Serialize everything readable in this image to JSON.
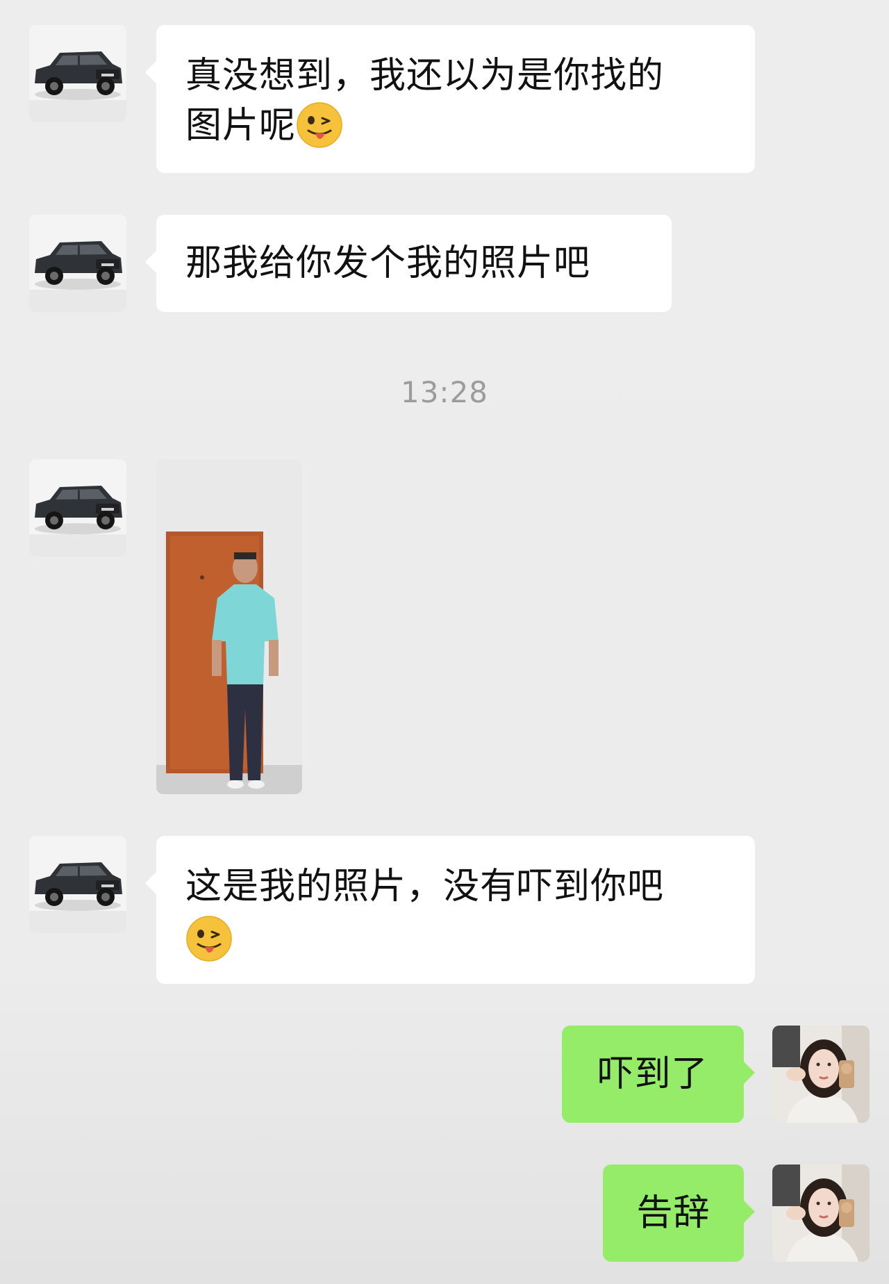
{
  "conversation": {
    "messages": [
      {
        "sender": "other",
        "avatar": "car-avatar",
        "text_lines": [
          "真没想到，我还以为是你找的",
          "图片呢"
        ],
        "emoji": "wink-tongue-emoji"
      },
      {
        "sender": "other",
        "avatar": "car-avatar",
        "text": "那我给你发个我的照片吧"
      },
      {
        "sender": "other",
        "avatar": "car-avatar",
        "type": "image"
      },
      {
        "sender": "other",
        "avatar": "car-avatar",
        "text": "这是我的照片，没有吓到你吧",
        "emoji": "wink-tongue-emoji"
      },
      {
        "sender": "self",
        "avatar": "woman-avatar",
        "text": "吓到了"
      },
      {
        "sender": "self",
        "avatar": "woman-avatar",
        "text": "告辞"
      }
    ],
    "timestamp": "13:28"
  },
  "colors": {
    "background": "#ededed",
    "incoming_bubble": "#ffffff",
    "outgoing_bubble": "#95ec69",
    "timestamp_text": "#9b9b9b"
  }
}
